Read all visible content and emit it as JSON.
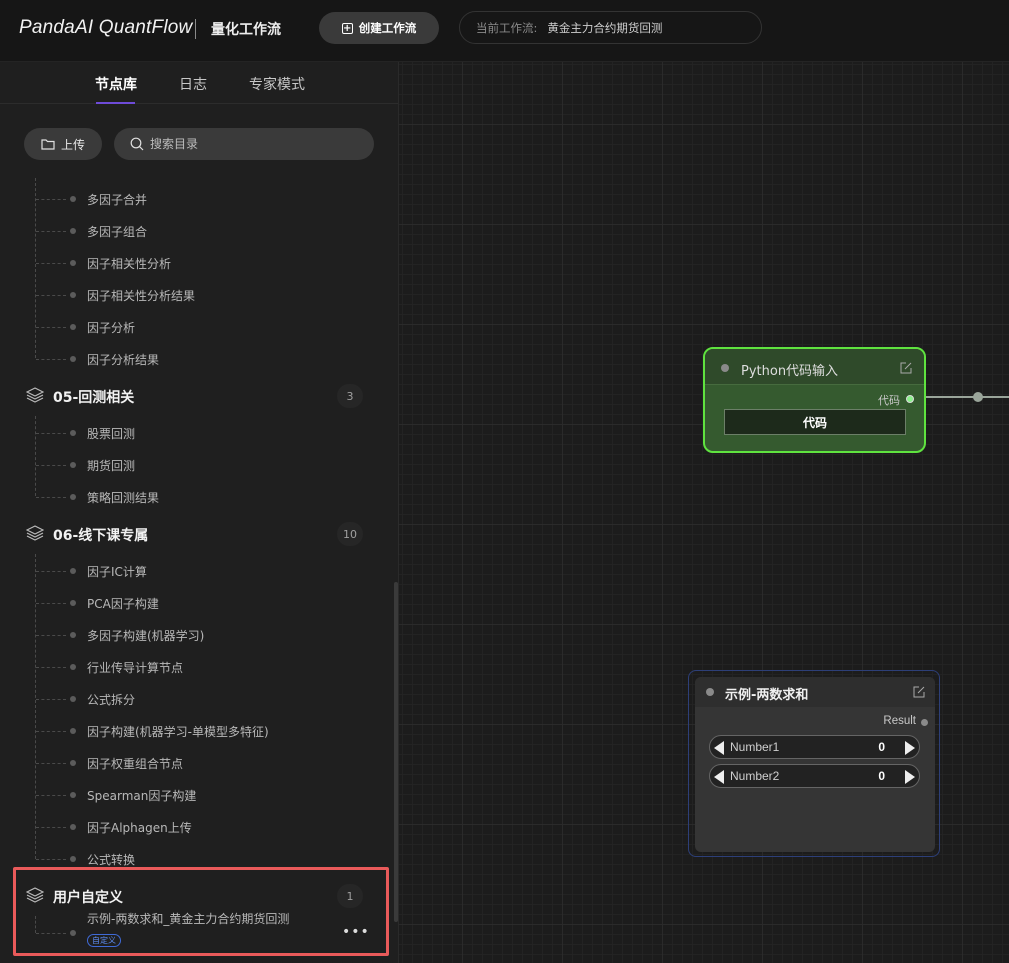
{
  "header": {
    "logo": "PandaAI QuantFlow",
    "subtitle": "量化工作流",
    "create_button": "创建工作流",
    "current_label": "当前工作流:",
    "current_value": "黄金主力合约期货回测"
  },
  "sidebar": {
    "tabs": [
      "节点库",
      "日志",
      "专家模式"
    ],
    "active_tab": "节点库",
    "upload_label": "上传",
    "search_placeholder": "搜索目录",
    "items_top": [
      "多因子合并",
      "多因子组合",
      "因子相关性分析",
      "因子相关性分析结果",
      "因子分析",
      "因子分析结果"
    ],
    "groups": [
      {
        "title": "05-回测相关",
        "count": "3",
        "items": [
          "股票回测",
          "期货回测",
          "策略回测结果"
        ]
      },
      {
        "title": "06-线下课专属",
        "count": "10",
        "items": [
          "因子IC计算",
          "PCA因子构建",
          "多因子构建(机器学习)",
          "行业传导计算节点",
          "公式拆分",
          "因子构建(机器学习-单模型多特征)",
          "因子权重组合节点",
          "Spearman因子构建",
          "因子Alphagen上传",
          "公式转换"
        ]
      },
      {
        "title": "用户自定义",
        "count": "1",
        "items": [
          "示例-两数求和_黄金主力合约期货回测"
        ],
        "badge": "自定义"
      }
    ]
  },
  "canvas": {
    "python_node": {
      "title": "Python代码输入",
      "output_label": "代码",
      "button_label": "代码"
    },
    "sum_node": {
      "title": "示例-两数求和",
      "output_label": "Result",
      "inputs": [
        {
          "label": "Number1",
          "value": "0"
        },
        {
          "label": "Number2",
          "value": "0"
        }
      ]
    }
  },
  "colors": {
    "accent": "#6e4bd8",
    "node_green_border": "#5fe33f",
    "highlight": "#e95a5a",
    "node_blue_border": "#2d3f78"
  }
}
